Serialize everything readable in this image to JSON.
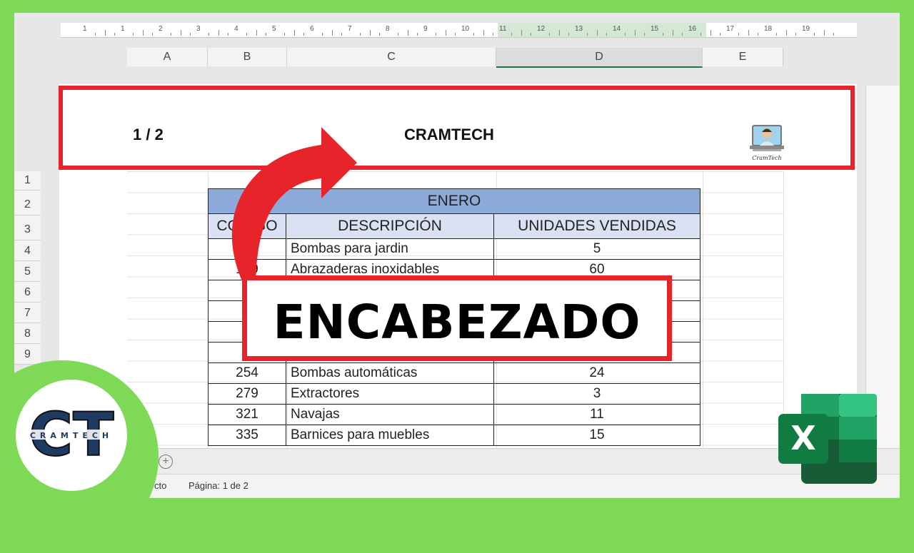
{
  "ruler": {
    "numbers": [
      "1",
      "1",
      "2",
      "3",
      "4",
      "5",
      "6",
      "7",
      "8",
      "9",
      "10",
      "11",
      "12",
      "13",
      "14",
      "15",
      "16",
      "17",
      "18",
      "19"
    ]
  },
  "columns": [
    "A",
    "B",
    "C",
    "D",
    "E"
  ],
  "rows": [
    "1",
    "2",
    "3",
    "4",
    "5",
    "6",
    "7",
    "8",
    "9"
  ],
  "header": {
    "page_number": "1 / 2",
    "company": "CRAMTECH",
    "thumb_caption": "CramTech"
  },
  "table": {
    "month": "ENERO",
    "col_headers": [
      "CODIGO",
      "DESCRIPCIÓN",
      "UNIDADES VENDIDAS"
    ],
    "rows": [
      [
        "145",
        "Bombas para jardin",
        "5"
      ],
      [
        "159",
        "Abrazaderas inoxidables",
        "60"
      ],
      [
        "",
        "",
        ""
      ],
      [
        "",
        "",
        ""
      ],
      [
        "",
        "",
        ""
      ],
      [
        "",
        "",
        ""
      ],
      [
        "254",
        "Bombas automáticas",
        "24"
      ],
      [
        "279",
        "Extractores",
        "3"
      ],
      [
        "321",
        "Navajas",
        "11"
      ],
      [
        "335",
        "Barnices para muebles",
        "15"
      ]
    ]
  },
  "callout": {
    "text": "ENCABEZADO"
  },
  "status": {
    "view": "cto",
    "page": "Página: 1 de 2",
    "add_sheet": "+"
  },
  "logo": {
    "letters": "CT",
    "brand": "CRAMTECH"
  },
  "excel": {
    "letter": "X"
  },
  "colors": {
    "frame_green": "#7ed957",
    "red": "#e8242b",
    "excel_green": "#217346",
    "month_fill": "#8eaadb",
    "header_fill": "#d9e1f2"
  }
}
